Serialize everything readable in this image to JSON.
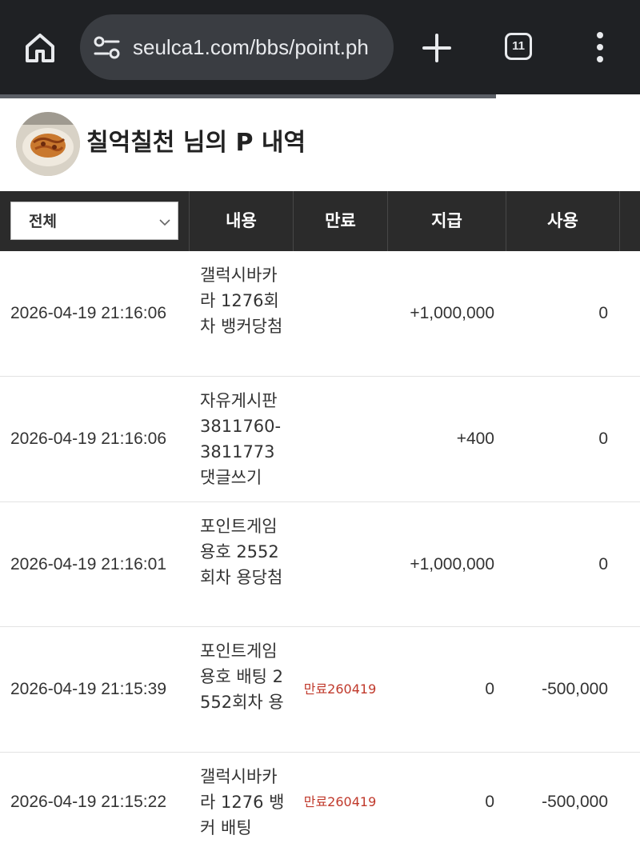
{
  "browser": {
    "url": "seulca1.com/bbs/point.ph",
    "tab_count": "11",
    "load_progress": 0.775
  },
  "header": {
    "title": "칠억칠천 님의 P 내역"
  },
  "table": {
    "filter_selected": "전체",
    "columns": [
      "내용",
      "만료",
      "지급",
      "사용"
    ],
    "rows": [
      {
        "date": "2026-04-19 21:16:06",
        "content": "갤럭시바카라 1276회차 뱅커당첨",
        "expire": "",
        "pay": "+1,000,000",
        "use": "0"
      },
      {
        "date": "2026-04-19 21:16:06",
        "content": "자유게시판 3811760-3811773 댓글쓰기",
        "expire": "",
        "pay": "+400",
        "use": "0"
      },
      {
        "date": "2026-04-19 21:16:01",
        "content": "포인트게임 용호 2552회차 용당첨",
        "expire": "",
        "pay": "+1,000,000",
        "use": "0"
      },
      {
        "date": "2026-04-19 21:15:39",
        "content": "포인트게임 용호 배팅 2552회차 용",
        "expire": "만료260419",
        "pay": "0",
        "use": "-500,000"
      },
      {
        "date": "2026-04-19 21:15:22",
        "content": "갤럭시바카라 1276 뱅커 배팅",
        "expire": "만료260419",
        "pay": "0",
        "use": "-500,000"
      }
    ]
  },
  "colors": {
    "browser_bg": "#1f2124",
    "table_header_bg": "#2b2b2b",
    "expire_text": "#c0392b"
  }
}
